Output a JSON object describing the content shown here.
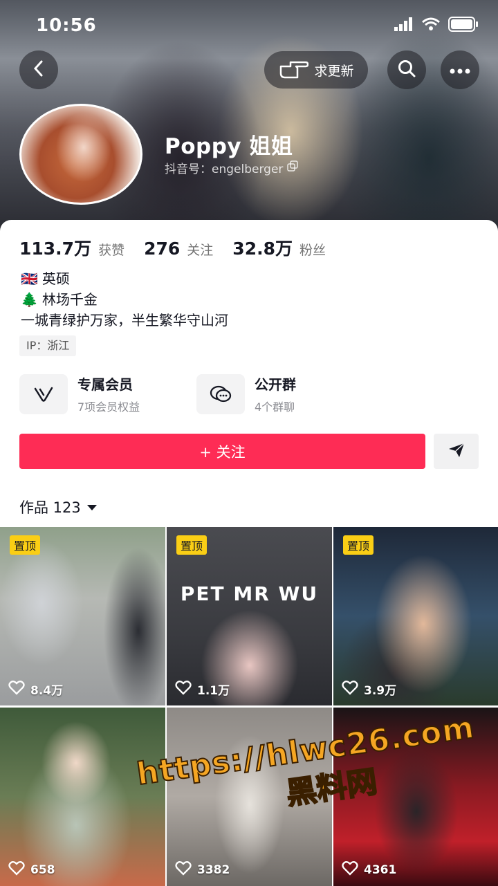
{
  "status_bar": {
    "time": "10:56"
  },
  "header": {
    "update_label": "求更新",
    "username": "Poppy 姐姐",
    "douyin_id": "抖音号：engelberger"
  },
  "stats": [
    {
      "value": "113.7万",
      "label": "获赞"
    },
    {
      "value": "276",
      "label": "关注"
    },
    {
      "value": "32.8万",
      "label": "粉丝"
    }
  ],
  "bio": {
    "line1_emoji": "🇬🇧",
    "line1": "英硕",
    "line2_emoji": "🌲",
    "line2": "林场千金",
    "line3": "一城青绿护万家，半生繁华守山河"
  },
  "ip_tag": "IP：浙江",
  "entries": {
    "member": {
      "title": "专属会员",
      "sub": "7项会员权益"
    },
    "group": {
      "title": "公开群",
      "sub": "4个群聊"
    }
  },
  "follow_label": "+ 关注",
  "works": {
    "label": "作品 123"
  },
  "pin_label": "置顶",
  "videos": [
    {
      "likes": "8.4万",
      "pinned": true
    },
    {
      "likes": "1.1万",
      "pinned": true,
      "overlay_text": "PET MR WU"
    },
    {
      "likes": "3.9万",
      "pinned": true
    },
    {
      "likes": "658",
      "pinned": false
    },
    {
      "likes": "3382",
      "pinned": false
    },
    {
      "likes": "4361",
      "pinned": false
    }
  ],
  "watermark": {
    "url": "https://hlwc26.com",
    "cn": "黑料网"
  },
  "colors": {
    "follow": "#fe2c55",
    "pin": "#face15",
    "watermark": "#f5a623"
  }
}
